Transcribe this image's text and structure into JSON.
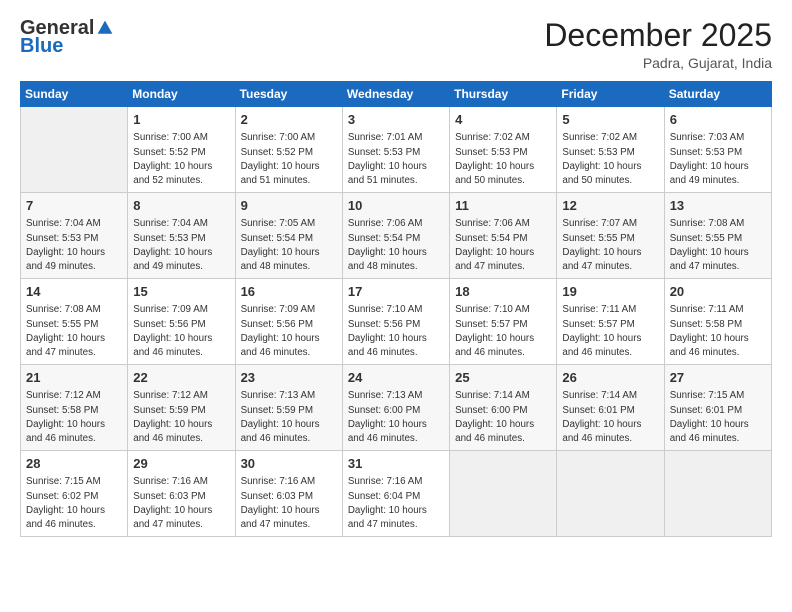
{
  "logo": {
    "general": "General",
    "blue": "Blue"
  },
  "header": {
    "month": "December 2025",
    "location": "Padra, Gujarat, India"
  },
  "weekdays": [
    "Sunday",
    "Monday",
    "Tuesday",
    "Wednesday",
    "Thursday",
    "Friday",
    "Saturday"
  ],
  "weeks": [
    [
      {
        "day": "",
        "sunrise": "",
        "sunset": "",
        "daylight": ""
      },
      {
        "day": "1",
        "sunrise": "Sunrise: 7:00 AM",
        "sunset": "Sunset: 5:52 PM",
        "daylight": "Daylight: 10 hours and 52 minutes."
      },
      {
        "day": "2",
        "sunrise": "Sunrise: 7:00 AM",
        "sunset": "Sunset: 5:52 PM",
        "daylight": "Daylight: 10 hours and 51 minutes."
      },
      {
        "day": "3",
        "sunrise": "Sunrise: 7:01 AM",
        "sunset": "Sunset: 5:53 PM",
        "daylight": "Daylight: 10 hours and 51 minutes."
      },
      {
        "day": "4",
        "sunrise": "Sunrise: 7:02 AM",
        "sunset": "Sunset: 5:53 PM",
        "daylight": "Daylight: 10 hours and 50 minutes."
      },
      {
        "day": "5",
        "sunrise": "Sunrise: 7:02 AM",
        "sunset": "Sunset: 5:53 PM",
        "daylight": "Daylight: 10 hours and 50 minutes."
      },
      {
        "day": "6",
        "sunrise": "Sunrise: 7:03 AM",
        "sunset": "Sunset: 5:53 PM",
        "daylight": "Daylight: 10 hours and 49 minutes."
      }
    ],
    [
      {
        "day": "7",
        "sunrise": "Sunrise: 7:04 AM",
        "sunset": "Sunset: 5:53 PM",
        "daylight": "Daylight: 10 hours and 49 minutes."
      },
      {
        "day": "8",
        "sunrise": "Sunrise: 7:04 AM",
        "sunset": "Sunset: 5:53 PM",
        "daylight": "Daylight: 10 hours and 49 minutes."
      },
      {
        "day": "9",
        "sunrise": "Sunrise: 7:05 AM",
        "sunset": "Sunset: 5:54 PM",
        "daylight": "Daylight: 10 hours and 48 minutes."
      },
      {
        "day": "10",
        "sunrise": "Sunrise: 7:06 AM",
        "sunset": "Sunset: 5:54 PM",
        "daylight": "Daylight: 10 hours and 48 minutes."
      },
      {
        "day": "11",
        "sunrise": "Sunrise: 7:06 AM",
        "sunset": "Sunset: 5:54 PM",
        "daylight": "Daylight: 10 hours and 47 minutes."
      },
      {
        "day": "12",
        "sunrise": "Sunrise: 7:07 AM",
        "sunset": "Sunset: 5:55 PM",
        "daylight": "Daylight: 10 hours and 47 minutes."
      },
      {
        "day": "13",
        "sunrise": "Sunrise: 7:08 AM",
        "sunset": "Sunset: 5:55 PM",
        "daylight": "Daylight: 10 hours and 47 minutes."
      }
    ],
    [
      {
        "day": "14",
        "sunrise": "Sunrise: 7:08 AM",
        "sunset": "Sunset: 5:55 PM",
        "daylight": "Daylight: 10 hours and 47 minutes."
      },
      {
        "day": "15",
        "sunrise": "Sunrise: 7:09 AM",
        "sunset": "Sunset: 5:56 PM",
        "daylight": "Daylight: 10 hours and 46 minutes."
      },
      {
        "day": "16",
        "sunrise": "Sunrise: 7:09 AM",
        "sunset": "Sunset: 5:56 PM",
        "daylight": "Daylight: 10 hours and 46 minutes."
      },
      {
        "day": "17",
        "sunrise": "Sunrise: 7:10 AM",
        "sunset": "Sunset: 5:56 PM",
        "daylight": "Daylight: 10 hours and 46 minutes."
      },
      {
        "day": "18",
        "sunrise": "Sunrise: 7:10 AM",
        "sunset": "Sunset: 5:57 PM",
        "daylight": "Daylight: 10 hours and 46 minutes."
      },
      {
        "day": "19",
        "sunrise": "Sunrise: 7:11 AM",
        "sunset": "Sunset: 5:57 PM",
        "daylight": "Daylight: 10 hours and 46 minutes."
      },
      {
        "day": "20",
        "sunrise": "Sunrise: 7:11 AM",
        "sunset": "Sunset: 5:58 PM",
        "daylight": "Daylight: 10 hours and 46 minutes."
      }
    ],
    [
      {
        "day": "21",
        "sunrise": "Sunrise: 7:12 AM",
        "sunset": "Sunset: 5:58 PM",
        "daylight": "Daylight: 10 hours and 46 minutes."
      },
      {
        "day": "22",
        "sunrise": "Sunrise: 7:12 AM",
        "sunset": "Sunset: 5:59 PM",
        "daylight": "Daylight: 10 hours and 46 minutes."
      },
      {
        "day": "23",
        "sunrise": "Sunrise: 7:13 AM",
        "sunset": "Sunset: 5:59 PM",
        "daylight": "Daylight: 10 hours and 46 minutes."
      },
      {
        "day": "24",
        "sunrise": "Sunrise: 7:13 AM",
        "sunset": "Sunset: 6:00 PM",
        "daylight": "Daylight: 10 hours and 46 minutes."
      },
      {
        "day": "25",
        "sunrise": "Sunrise: 7:14 AM",
        "sunset": "Sunset: 6:00 PM",
        "daylight": "Daylight: 10 hours and 46 minutes."
      },
      {
        "day": "26",
        "sunrise": "Sunrise: 7:14 AM",
        "sunset": "Sunset: 6:01 PM",
        "daylight": "Daylight: 10 hours and 46 minutes."
      },
      {
        "day": "27",
        "sunrise": "Sunrise: 7:15 AM",
        "sunset": "Sunset: 6:01 PM",
        "daylight": "Daylight: 10 hours and 46 minutes."
      }
    ],
    [
      {
        "day": "28",
        "sunrise": "Sunrise: 7:15 AM",
        "sunset": "Sunset: 6:02 PM",
        "daylight": "Daylight: 10 hours and 46 minutes."
      },
      {
        "day": "29",
        "sunrise": "Sunrise: 7:16 AM",
        "sunset": "Sunset: 6:03 PM",
        "daylight": "Daylight: 10 hours and 47 minutes."
      },
      {
        "day": "30",
        "sunrise": "Sunrise: 7:16 AM",
        "sunset": "Sunset: 6:03 PM",
        "daylight": "Daylight: 10 hours and 47 minutes."
      },
      {
        "day": "31",
        "sunrise": "Sunrise: 7:16 AM",
        "sunset": "Sunset: 6:04 PM",
        "daylight": "Daylight: 10 hours and 47 minutes."
      },
      {
        "day": "",
        "sunrise": "",
        "sunset": "",
        "daylight": ""
      },
      {
        "day": "",
        "sunrise": "",
        "sunset": "",
        "daylight": ""
      },
      {
        "day": "",
        "sunrise": "",
        "sunset": "",
        "daylight": ""
      }
    ]
  ]
}
